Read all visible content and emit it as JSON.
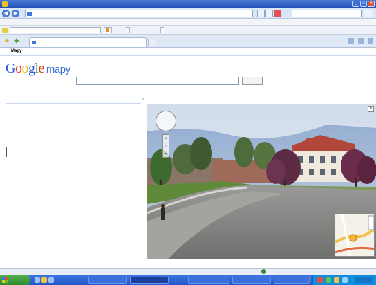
{
  "window": {
    "title": "",
    "min_label": "_",
    "max_label": "□",
    "close_label": "×"
  },
  "address": {
    "back_glyph": "◀",
    "forward_glyph": "▶",
    "url": "",
    "livesearch_placeholder": ""
  },
  "menu": {
    "items": [
      "",
      "",
      "",
      "",
      "",
      ""
    ]
  },
  "google_toolbar": {
    "search_btn": "",
    "pagerank_btn": "",
    "options_btn": ""
  },
  "tabs": {
    "active_tab": ""
  },
  "command_bar": {
    "items": [
      "",
      "",
      ""
    ]
  },
  "google_nav": {
    "links": [
      "",
      "",
      ""
    ],
    "active": "Mapy",
    "more_links": [
      "",
      "",
      "",
      ""
    ],
    "right_links": ""
  },
  "logo": {
    "g1": "G",
    "o1": "o",
    "o2": "o",
    "g2": "g",
    "l": "l",
    "e": "e",
    "product": "mapy",
    "sub": ""
  },
  "search": {
    "value": "",
    "button": "",
    "hint": "",
    "links": ""
  },
  "left_panel": {
    "header_links": [
      "",
      ""
    ],
    "link_top": "",
    "section_title": "",
    "links": [
      "",
      "",
      "",
      ""
    ],
    "feature_line1": "",
    "feature_line2": ""
  },
  "map": {
    "tools": "",
    "sv_ctrl_glyph": "",
    "zoom_plus": "+",
    "zoom_minus": "−",
    "close_glyph": "×",
    "collapse_glyph": "«",
    "footer_link": "",
    "footer_text": ""
  },
  "status": {
    "zone": "",
    "zoom": ""
  },
  "taskbar": {
    "start": "",
    "items": [
      "",
      "",
      "",
      "",
      ""
    ]
  },
  "colors": {
    "link": "#2222cc",
    "titlebar": "#1f4fb6",
    "sky": "#9fb6d6"
  }
}
